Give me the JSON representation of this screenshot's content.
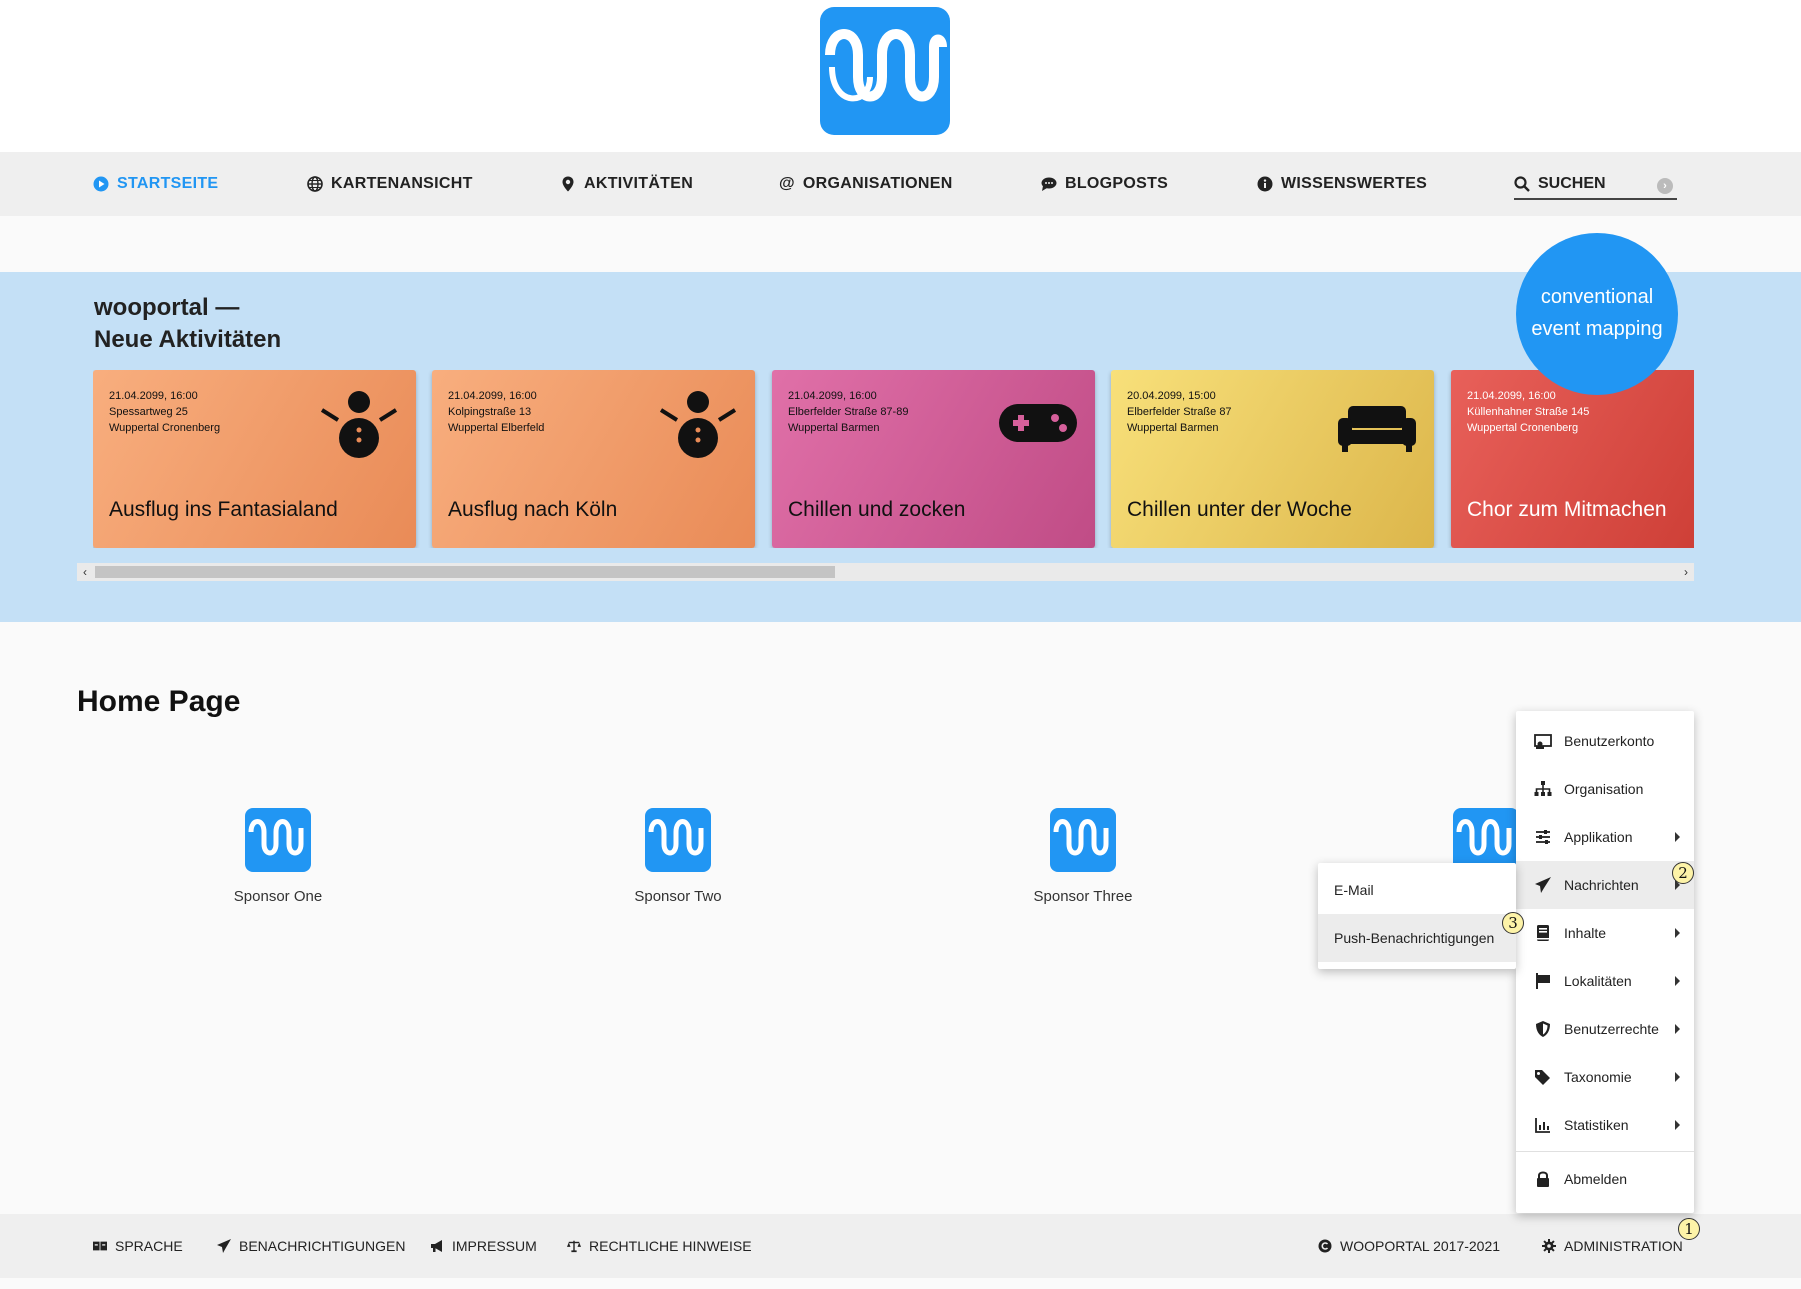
{
  "nav": {
    "items": [
      {
        "label": "STARTSEITE",
        "icon": "play-circle-icon"
      },
      {
        "label": "KARTENANSICHT",
        "icon": "globe-icon"
      },
      {
        "label": "AKTIVITÄTEN",
        "icon": "map-marker-icon"
      },
      {
        "label": "ORGANISATIONEN",
        "icon": "at-icon"
      },
      {
        "label": "BLOGPOSTS",
        "icon": "comment-icon"
      },
      {
        "label": "WISSENSWERTES",
        "icon": "info-circle-icon"
      }
    ],
    "search_label": "SUCHEN"
  },
  "accent_color": "#2196f3",
  "activities": {
    "title_line1": "wooportal —",
    "title_line2": "Neue Aktivitäten",
    "bubble_line1": "conventional",
    "bubble_line2": "event mapping",
    "cards": [
      {
        "date": "21.04.2099, 16:00",
        "street": "Spessartweg 25",
        "district": "Wuppertal Cronenberg",
        "title": "Ausflug ins Fantasialand",
        "icon": "snowman-icon"
      },
      {
        "date": "21.04.2099, 16:00",
        "street": "Kolpingstraße 13",
        "district": "Wuppertal Elberfeld",
        "title": "Ausflug nach Köln",
        "icon": "snowman-icon"
      },
      {
        "date": "21.04.2099, 16:00",
        "street": "Elberfelder Straße 87-89",
        "district": "Wuppertal Barmen",
        "title": "Chillen und zocken",
        "icon": "gamepad-icon"
      },
      {
        "date": "20.04.2099, 15:00",
        "street": "Elberfelder Straße 87",
        "district": "Wuppertal Barmen",
        "title": "Chillen unter der Woche",
        "icon": "couch-icon"
      },
      {
        "date": "21.04.2099, 16:00",
        "street": "Küllenhahner Straße 145",
        "district": "Wuppertal Cronenberg",
        "title": "Chor zum Mitmachen",
        "icon": ""
      }
    ]
  },
  "home": {
    "title": "Home Page",
    "sponsors": [
      "Sponsor One",
      "Sponsor Two",
      "Sponsor Three"
    ]
  },
  "admin_menu": {
    "items": [
      {
        "label": "Benutzerkonto",
        "icon": "user-card-icon"
      },
      {
        "label": "Organisation",
        "icon": "sitemap-icon"
      },
      {
        "label": "Applikation",
        "icon": "sliders-icon"
      },
      {
        "label": "Nachrichten",
        "icon": "paper-plane-icon"
      },
      {
        "label": "Inhalte",
        "icon": "book-icon"
      },
      {
        "label": "Lokalitäten",
        "icon": "flag-icon"
      },
      {
        "label": "Benutzerrechte",
        "icon": "shield-icon"
      },
      {
        "label": "Taxonomie",
        "icon": "tags-icon"
      },
      {
        "label": "Statistiken",
        "icon": "bar-chart-icon"
      },
      {
        "label": "Abmelden",
        "icon": "lock-icon"
      }
    ],
    "submenu": [
      "E-Mail",
      "Push-Benachrichtigungen"
    ]
  },
  "footer": {
    "sprache": "SPRACHE",
    "benachrichtigungen": "BENACHRICHTIGUNGEN",
    "impressum": "IMPRESSUM",
    "rechtliche_hinweise": "RECHTLICHE HINWEISE",
    "copyright": "WOOPORTAL 2017-2021",
    "administration": "ADMINISTRATION"
  },
  "badges": [
    "1",
    "2",
    "3"
  ]
}
